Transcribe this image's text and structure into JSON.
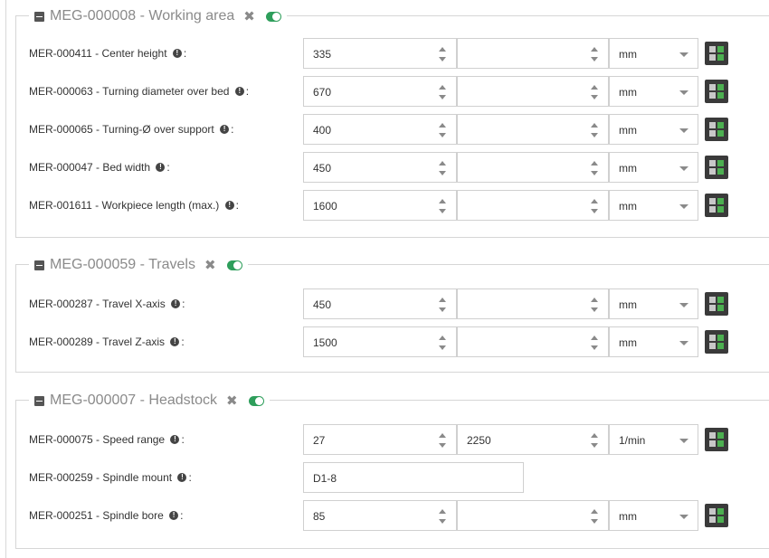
{
  "icons": {
    "collapse": "minus-square-icon",
    "remove": "close-icon",
    "toggle": "toggle-on-icon",
    "info": "info-circle-icon",
    "calculator": "calculator-icon"
  },
  "accent_color": "#2e9e5b",
  "groups": [
    {
      "title": "MEG-000008 - Working area",
      "rows": [
        {
          "label": "MER-000411 - Center height",
          "value": "335",
          "value2": "",
          "unit": "mm"
        },
        {
          "label": "MER-000063 - Turning diameter over bed",
          "value": "670",
          "value2": "",
          "unit": "mm"
        },
        {
          "label": "MER-000065 - Turning-Ø over support",
          "value": "400",
          "value2": "",
          "unit": "mm"
        },
        {
          "label": "MER-000047 - Bed width",
          "value": "450",
          "value2": "",
          "unit": "mm"
        },
        {
          "label": "MER-001611 - Workpiece length (max.)",
          "value": "1600",
          "value2": "",
          "unit": "mm"
        }
      ]
    },
    {
      "title": "MEG-000059 - Travels",
      "rows": [
        {
          "label": "MER-000287 - Travel X-axis",
          "value": "450",
          "value2": "",
          "unit": "mm"
        },
        {
          "label": "MER-000289 - Travel Z-axis",
          "value": "1500",
          "value2": "",
          "unit": "mm"
        }
      ]
    },
    {
      "title": "MEG-000007 - Headstock",
      "rows": [
        {
          "label": "MER-000075 - Speed range",
          "value": "27",
          "value2": "2250",
          "unit": "1/min"
        },
        {
          "label": "MER-000259 - Spindle mount",
          "value": "D1-8"
        },
        {
          "label": "MER-000251 - Spindle bore",
          "value": "85",
          "value2": "",
          "unit": "mm"
        }
      ]
    }
  ],
  "label_suffix": ":",
  "info_glyph": "!"
}
